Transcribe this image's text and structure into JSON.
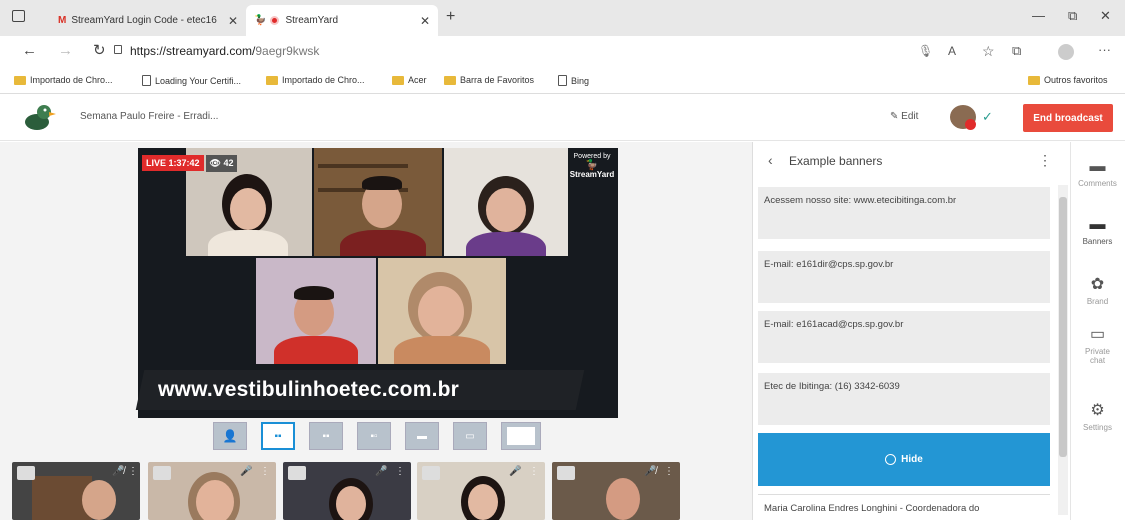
{
  "browser": {
    "tabs": [
      {
        "label": "StreamYard Login Code - etec16",
        "icon": "gmail-icon"
      },
      {
        "label": "StreamYard",
        "icon": "streamyard-icon"
      }
    ],
    "new_tab": "+",
    "url_host": "https://streamyard.com/",
    "url_path": "9aegr9kwsk",
    "bookmarks": [
      "Importado de Chro...",
      "Loading Your Certifi...",
      "Importado de Chro...",
      "Acer",
      "Barra de Favoritos",
      "Bing"
    ],
    "other_favorites": "Outros favoritos"
  },
  "app": {
    "broadcast_title": "Semana Paulo Freire - Erradi...",
    "edit_label": "Edit",
    "end_label": "End broadcast",
    "accent": "#e94b3c"
  },
  "stage": {
    "live_label": "LIVE 1:37:42",
    "viewers": "42",
    "banner_text": "www.vestibulinhoetec.com.br",
    "powered_by": "Powered by",
    "powered_brand": "StreamYard"
  },
  "panel": {
    "back": "‹",
    "title": "Example banners",
    "menu": "⋮",
    "banners": [
      "Acessem nosso site: www.etecibitinga.com.br",
      "E-mail: e161dir@cps.sp.gov.br",
      "E-mail: e161acad@cps.sp.gov.br",
      "Etec de Ibitinga: (16) 3342-6039"
    ],
    "hide_label": "Hide",
    "last_banner": "Maria Carolina Endres Longhini - Coordenadora do"
  },
  "rail": {
    "items": [
      {
        "label": "Comments",
        "icon": "comment-icon"
      },
      {
        "label": "Banners",
        "icon": "banner-icon"
      },
      {
        "label": "Brand",
        "icon": "palette-icon"
      },
      {
        "label": "Private chat",
        "icon": "chat-icon"
      },
      {
        "label": "Settings",
        "icon": "gear-icon"
      }
    ]
  }
}
